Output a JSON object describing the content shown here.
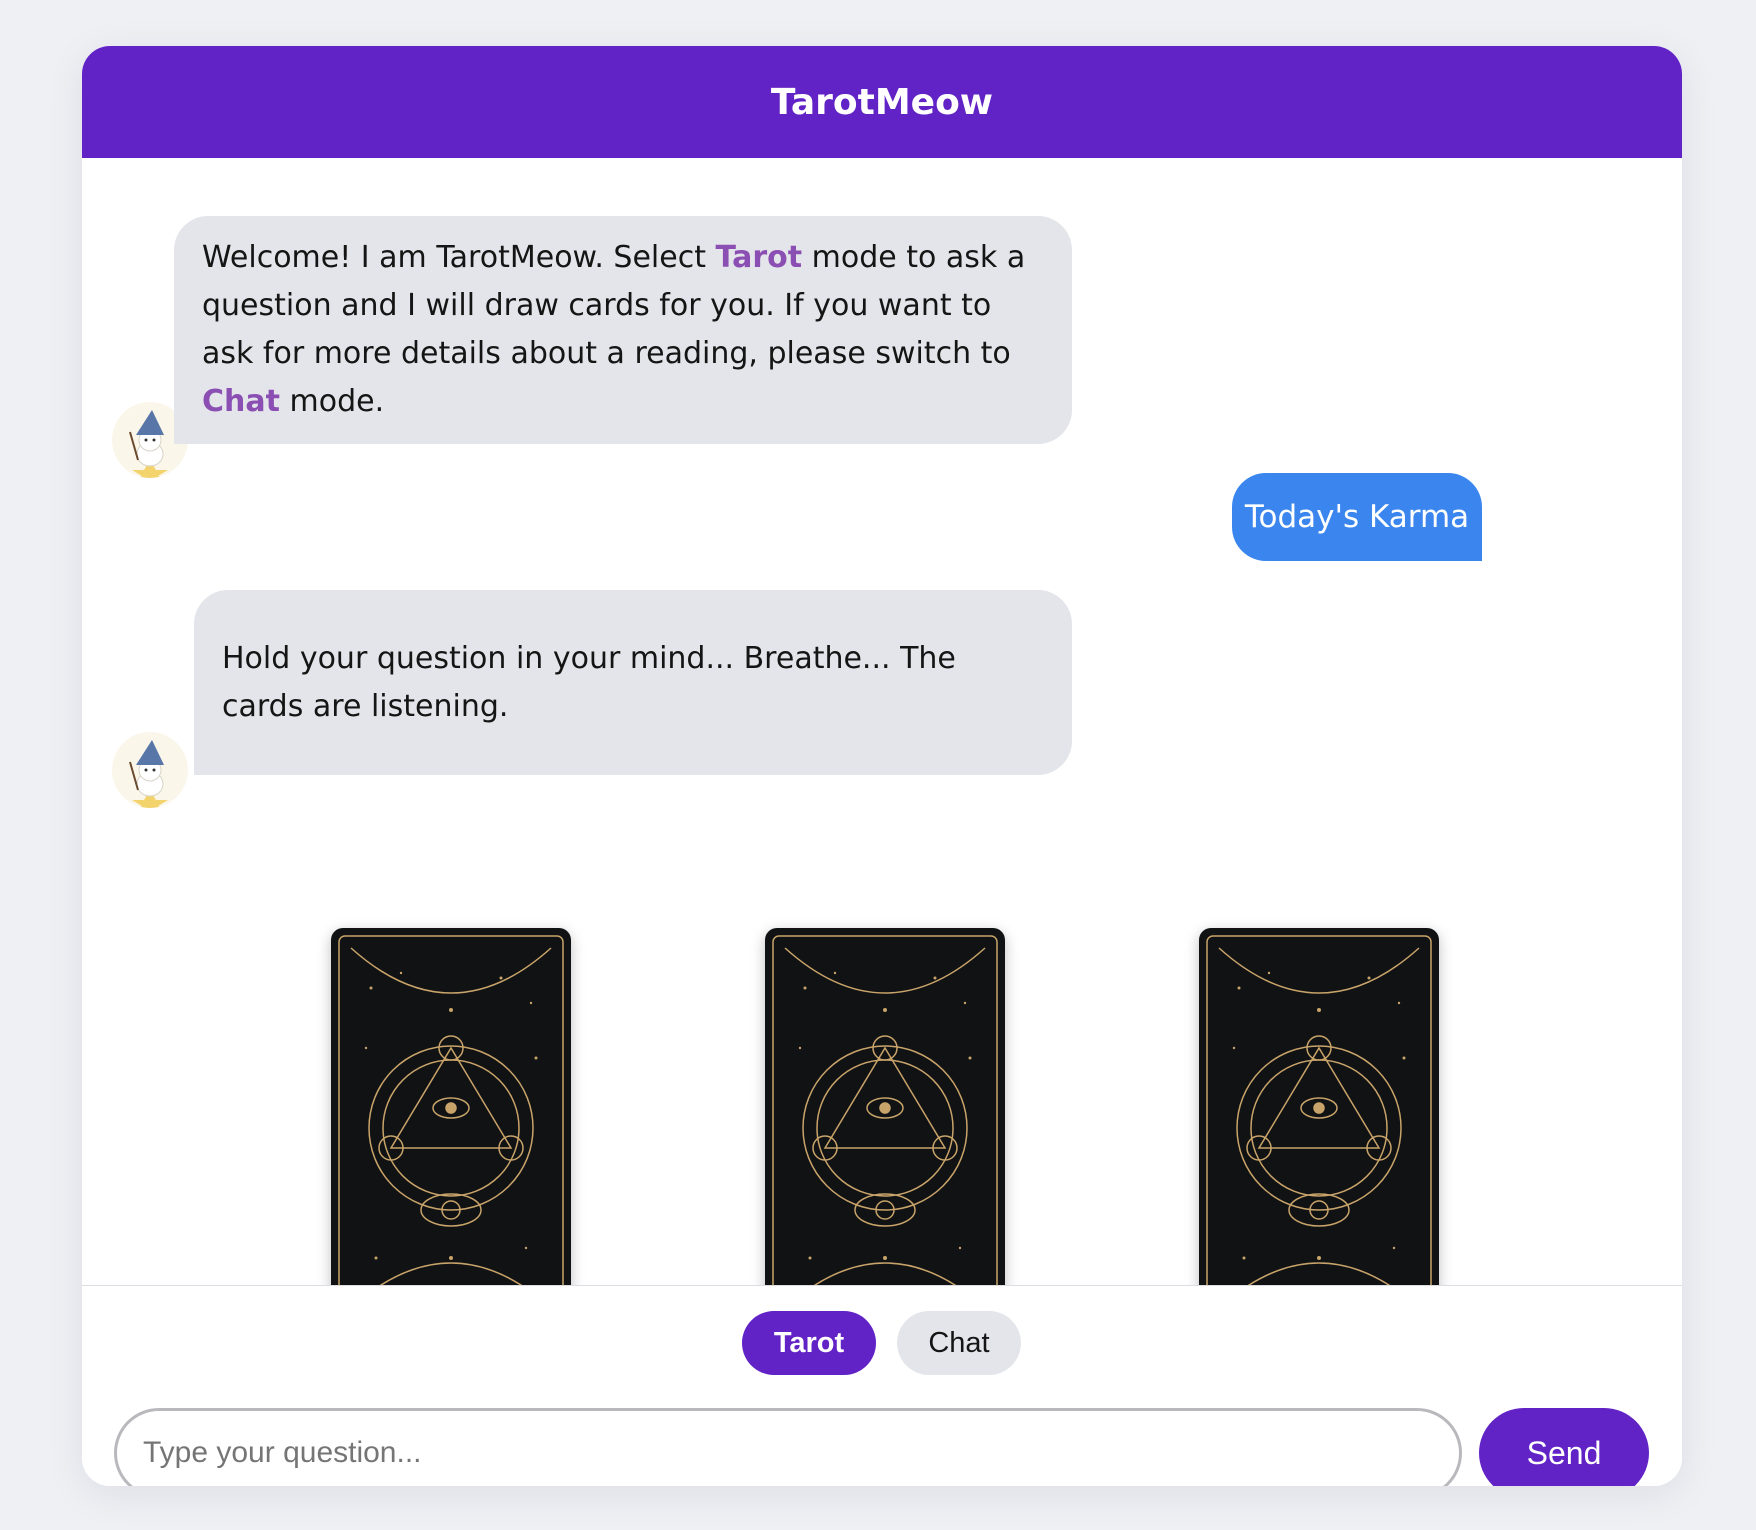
{
  "header": {
    "title": "TarotMeow"
  },
  "messages": {
    "welcome": {
      "part1": "Welcome! I am TarotMeow. Select ",
      "tarot_word": "Tarot",
      "part2": " mode to ask a question and I will draw cards for you. If you want to ask for more details about a reading, please switch to ",
      "chat_word": "Chat",
      "part3": " mode."
    },
    "user_message": "Today's Karma",
    "hold": "Hold your question in your mind... Breathe... The cards are listening."
  },
  "cards": [
    {
      "state": "face-down"
    },
    {
      "state": "face-down"
    },
    {
      "state": "face-down"
    }
  ],
  "modes": {
    "tarot": "Tarot",
    "chat": "Chat",
    "selected": "Tarot"
  },
  "input": {
    "placeholder": "Type your question..."
  },
  "send": {
    "label": "Send"
  },
  "colors": {
    "brand": "#6122c6",
    "user_bubble": "#3a86ee",
    "bot_bubble": "#e4e5ea",
    "highlight": "#8b4fb3",
    "card_gold": "#c9a46a"
  }
}
